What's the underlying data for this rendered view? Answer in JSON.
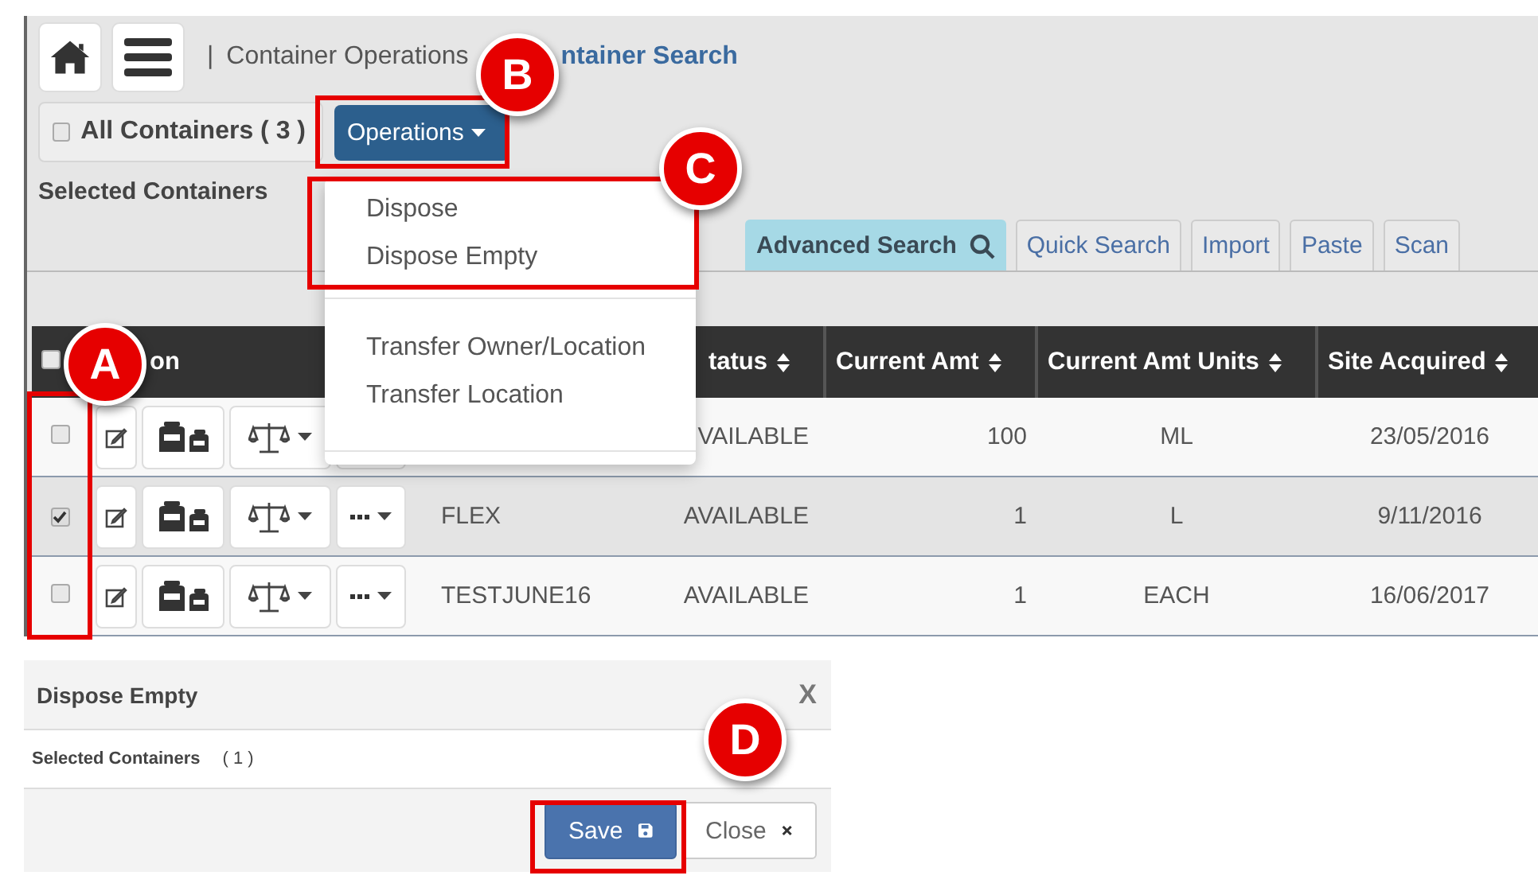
{
  "breadcrumb": {
    "separator": "|",
    "parent": "Container Operations",
    "current": "ntainer Search"
  },
  "all_containers": {
    "label": "All Containers ( 3 )",
    "checked": false
  },
  "operations_button": {
    "label": "Operations"
  },
  "operations_menu": {
    "sections": [
      {
        "items": [
          "Dispose",
          "Dispose Empty"
        ]
      },
      {
        "items": [
          "Transfer Owner/Location",
          "Transfer Location"
        ]
      }
    ]
  },
  "selected_containers_label": "Selected Containers",
  "search_tabs": [
    {
      "label": "Advanced Search",
      "selected": true
    },
    {
      "label": "Quick Search",
      "selected": false
    },
    {
      "label": "Import",
      "selected": false
    },
    {
      "label": "Paste",
      "selected": false
    },
    {
      "label": "Scan",
      "selected": false
    }
  ],
  "table": {
    "select_all_checked": false,
    "columns": [
      {
        "kind": "action",
        "label": "on",
        "sortable": false
      },
      {
        "kind": "name"
      },
      {
        "kind": "status",
        "label": "tatus",
        "sortable": true
      },
      {
        "kind": "amount",
        "label": "Current Amt",
        "sortable": true
      },
      {
        "kind": "units",
        "label": "Current Amt Units",
        "sortable": true
      },
      {
        "kind": "site",
        "label": "Site Acquired",
        "sortable": true
      }
    ],
    "rows": [
      {
        "checked": false,
        "status": "VAILABLE",
        "current_amt": "100",
        "units": "ML",
        "site_acquired": "23/05/2016"
      },
      {
        "checked": true,
        "name": "FLEX",
        "status": "AVAILABLE",
        "current_amt": "1",
        "units": "L",
        "site_acquired": "9/11/2016"
      },
      {
        "checked": false,
        "name": "TESTJUNE16",
        "status": "AVAILABLE",
        "current_amt": "1",
        "units": "EACH",
        "site_acquired": "16/06/2017"
      }
    ]
  },
  "dialog": {
    "title": "Dispose Empty",
    "close_mark": "X",
    "selected_label": "Selected Containers",
    "selected_count": "( 1 )",
    "buttons": [
      {
        "label": "Save",
        "kind": "primary"
      },
      {
        "label": "Close",
        "kind": "default"
      }
    ]
  },
  "callouts": [
    {
      "label": "A"
    },
    {
      "label": "B"
    },
    {
      "label": "C"
    },
    {
      "label": "D"
    }
  ]
}
